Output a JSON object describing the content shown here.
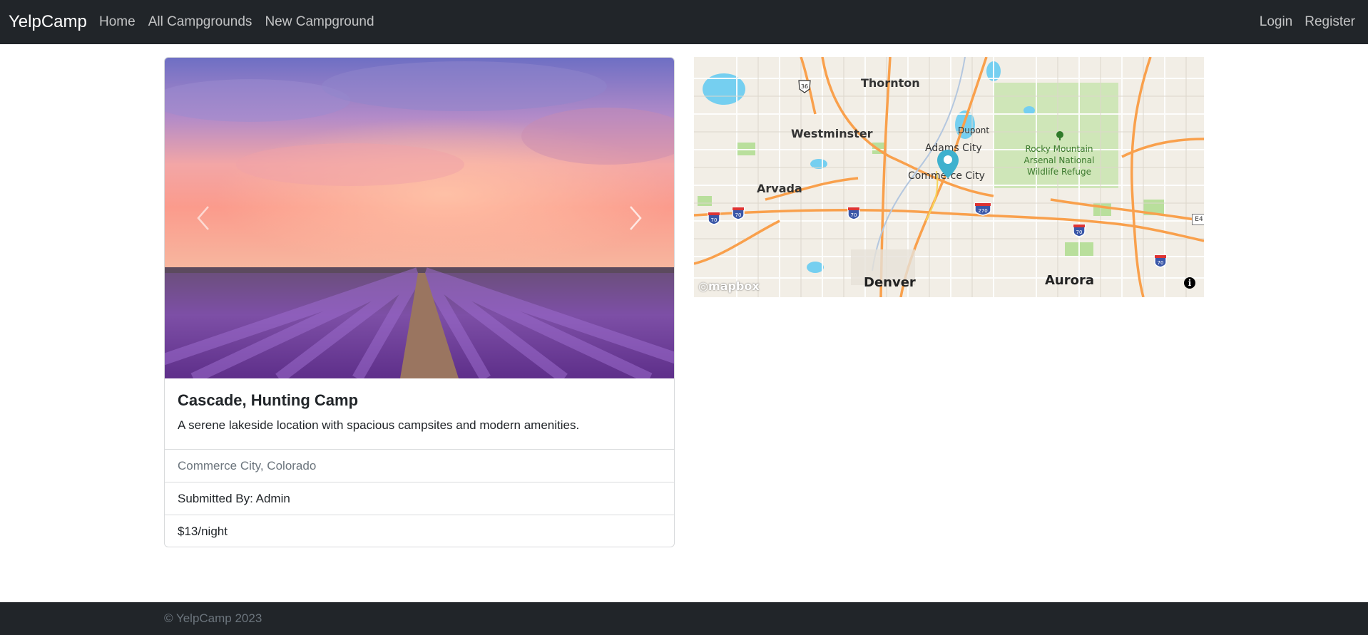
{
  "navbar": {
    "brand": "YelpCamp",
    "links": [
      "Home",
      "All Campgrounds",
      "New Campground"
    ],
    "right_links": [
      "Login",
      "Register"
    ]
  },
  "campground": {
    "title": "Cascade, Hunting Camp",
    "description": "A serene lakeside location with spacious campsites and modern amenities.",
    "location": "Commerce City, Colorado",
    "submitted_by": "Submitted By: Admin",
    "price": "$13/night"
  },
  "carousel": {
    "image_name": "lavender-field-sunset-photo",
    "prev_icon": "chevron-left-icon",
    "next_icon": "chevron-right-icon"
  },
  "map": {
    "cities": {
      "thornton": "Thornton",
      "westminster": "Westminster",
      "dupont": "Dupont",
      "adams_city": "Adams City",
      "commerce_city": "Commerce City",
      "arvada": "Arvada",
      "denver": "Denver",
      "aurora": "Aurora"
    },
    "park": {
      "line1": "Rocky Mountain",
      "line2": "Arsenal National",
      "line3": "Wildlife Refuge"
    },
    "shields": {
      "us36": "36",
      "i70": "70",
      "i270": "270",
      "e470": "E4"
    },
    "logo": "mapbox",
    "info_icon": "i",
    "marker_color": "#3fb1ce"
  },
  "footer": {
    "text": "© YelpCamp 2023"
  }
}
